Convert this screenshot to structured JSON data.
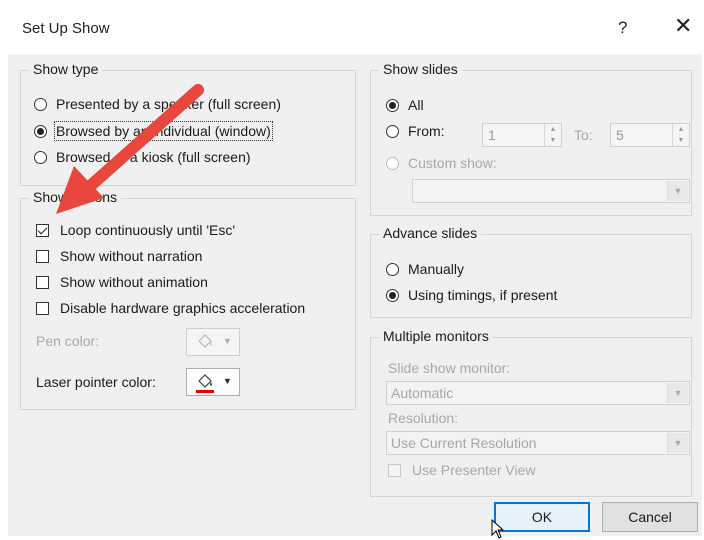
{
  "dialog": {
    "title": "Set Up Show",
    "help": "?",
    "close": "✕"
  },
  "show_type": {
    "legend": "Show type",
    "options": [
      {
        "label": "Presented by a speaker (full screen)",
        "selected": false
      },
      {
        "label": "Browsed by an individual (window)",
        "selected": true
      },
      {
        "label": "Browsed at a kiosk (full screen)",
        "selected": false
      }
    ]
  },
  "show_options": {
    "legend": "Show options",
    "checks": [
      {
        "label": "Loop continuously until 'Esc'",
        "checked": true
      },
      {
        "label": "Show without narration",
        "checked": false
      },
      {
        "label": "Show without animation",
        "checked": false
      },
      {
        "label": "Disable hardware graphics acceleration",
        "checked": false
      }
    ],
    "pen_color_label": "Pen color:",
    "laser_color_label": "Laser pointer color:",
    "laser_color": "#e00000"
  },
  "show_slides": {
    "legend": "Show slides",
    "all_label": "All",
    "from_label": "From:",
    "from_value": "1",
    "to_label": "To:",
    "to_value": "5",
    "custom_label": "Custom show:"
  },
  "advance_slides": {
    "legend": "Advance slides",
    "manually_label": "Manually",
    "timings_label": "Using timings, if present"
  },
  "multiple_monitors": {
    "legend": "Multiple monitors",
    "monitor_label": "Slide show monitor:",
    "monitor_value": "Automatic",
    "resolution_label": "Resolution:",
    "resolution_value": "Use Current Resolution",
    "presenter_view_label": "Use Presenter View"
  },
  "buttons": {
    "ok": "OK",
    "cancel": "Cancel"
  },
  "annotation": {
    "arrow_color": "#e8473d"
  }
}
